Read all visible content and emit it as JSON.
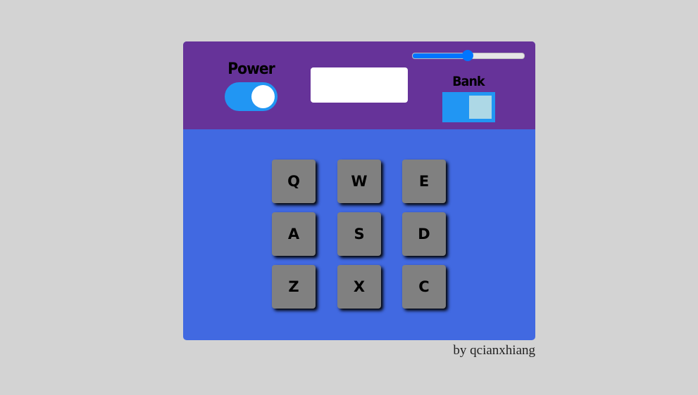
{
  "power": {
    "label": "Power",
    "on": true
  },
  "display": {
    "text": ""
  },
  "volume": {
    "value": 0.5
  },
  "bank": {
    "label": "Bank",
    "on": true
  },
  "pads": [
    {
      "key": "Q"
    },
    {
      "key": "W"
    },
    {
      "key": "E"
    },
    {
      "key": "A"
    },
    {
      "key": "S"
    },
    {
      "key": "D"
    },
    {
      "key": "Z"
    },
    {
      "key": "X"
    },
    {
      "key": "C"
    }
  ],
  "footer": {
    "credit": "by qcianxhiang"
  },
  "colors": {
    "page_background": "#d3d3d3",
    "top_panel": "#663399",
    "pad_area": "#4169e1",
    "toggle": "#2196f3",
    "bank_knob": "#add8e6",
    "pad": "#808080",
    "slider": "#0075ff"
  }
}
